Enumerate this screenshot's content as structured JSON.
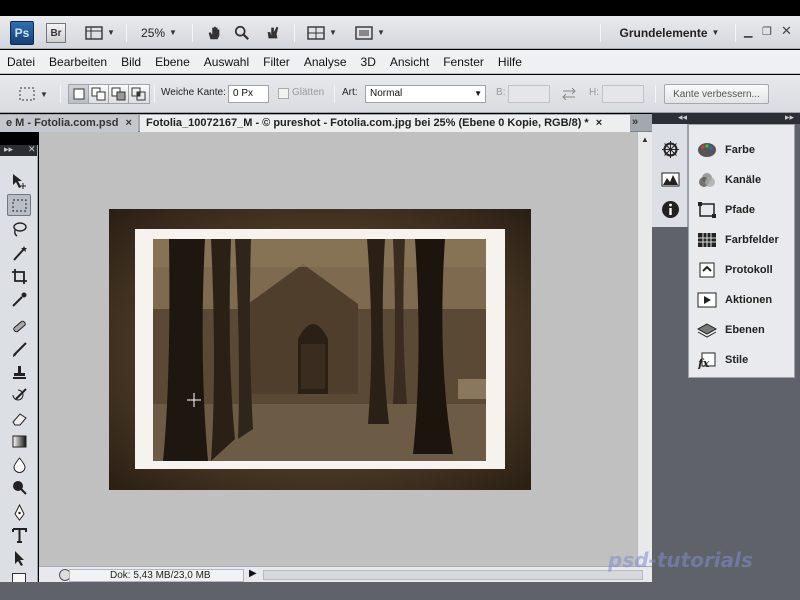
{
  "app": {
    "logo": "Ps",
    "bridge": "Br",
    "zoom": "25%",
    "workspace": "Grundelemente"
  },
  "menu": [
    "Datei",
    "Bearbeiten",
    "Bild",
    "Ebene",
    "Auswahl",
    "Filter",
    "Analyse",
    "3D",
    "Ansicht",
    "Fenster",
    "Hilfe"
  ],
  "options": {
    "feather_label": "Weiche Kante:",
    "feather_value": "0 Px",
    "antialias_label": "Glätten",
    "style_label": "Art:",
    "style_value": "Normal",
    "width_label": "B:",
    "height_label": "H:",
    "refine_label": "Kante verbessern..."
  },
  "tabs": [
    {
      "label": "e M - Fotolia.com.psd",
      "close": "×"
    },
    {
      "label": "Fotolia_10072167_M - © pureshot - Fotolia.com.jpg bei 25% (Ebene 0 Kopie, RGB/8) *",
      "close": "×"
    }
  ],
  "tab_overflow": "»",
  "status": {
    "doc_size": "Dok: 5,43 MB/23,0 MB"
  },
  "panels": [
    {
      "label": "Farbe",
      "icon": "palette-icon"
    },
    {
      "label": "Kanäle",
      "icon": "channels-icon"
    },
    {
      "label": "Pfade",
      "icon": "paths-icon"
    },
    {
      "label": "Farbfelder",
      "icon": "swatches-icon"
    },
    {
      "label": "Protokoll",
      "icon": "history-icon"
    },
    {
      "label": "Aktionen",
      "icon": "actions-icon"
    },
    {
      "label": "Ebenen",
      "icon": "layers-icon"
    },
    {
      "label": "Stile",
      "icon": "styles-icon"
    }
  ],
  "watermark": "psd-tutorials"
}
